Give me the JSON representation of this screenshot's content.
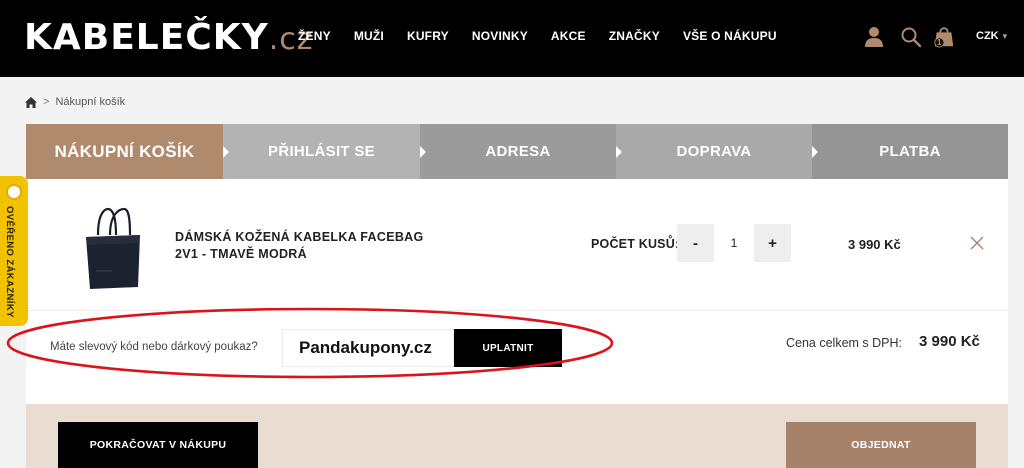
{
  "header": {
    "logo_main": "KABELEČKY",
    "logo_suffix": ".cz",
    "nav": [
      "ŽENY",
      "MUŽI",
      "KUFRY",
      "NOVINKY",
      "AKCE",
      "ZNAČKY",
      "VŠE O NÁKUPU"
    ],
    "currency": "CZK",
    "cart_count": "1"
  },
  "breadcrumb": {
    "separator": ">",
    "current": "Nákupní košík"
  },
  "steps": [
    "NÁKUPNÍ KOŠÍK",
    "PŘIHLÁSIT SE",
    "ADRESA",
    "DOPRAVA",
    "PLATBA"
  ],
  "cart": {
    "product_name": "DÁMSKÁ KOŽENÁ KABELKA FACEBAG 2V1 - TMAVĚ MODRÁ",
    "qty_label": "POČET KUSŮ:",
    "qty_minus": "-",
    "qty_value": "1",
    "qty_plus": "+",
    "price": "3 990 Kč"
  },
  "coupon": {
    "label": "Máte slevový kód nebo dárkový poukaz?",
    "value": "Pandakupony.cz",
    "button": "UPLATNIT"
  },
  "total": {
    "label": "Cena celkem s DPH:",
    "value": "3 990 Kč"
  },
  "actions": {
    "continue": "POKRAČOVAT V NÁKUPU",
    "order": "OBJEDNAT"
  },
  "side_badge": "OVĚŘENO ZÁKAZNÍKY",
  "colors": {
    "accent": "#b08a6c",
    "header_bg": "#000000",
    "annotation": "#d9141b",
    "badge": "#f2c200"
  }
}
